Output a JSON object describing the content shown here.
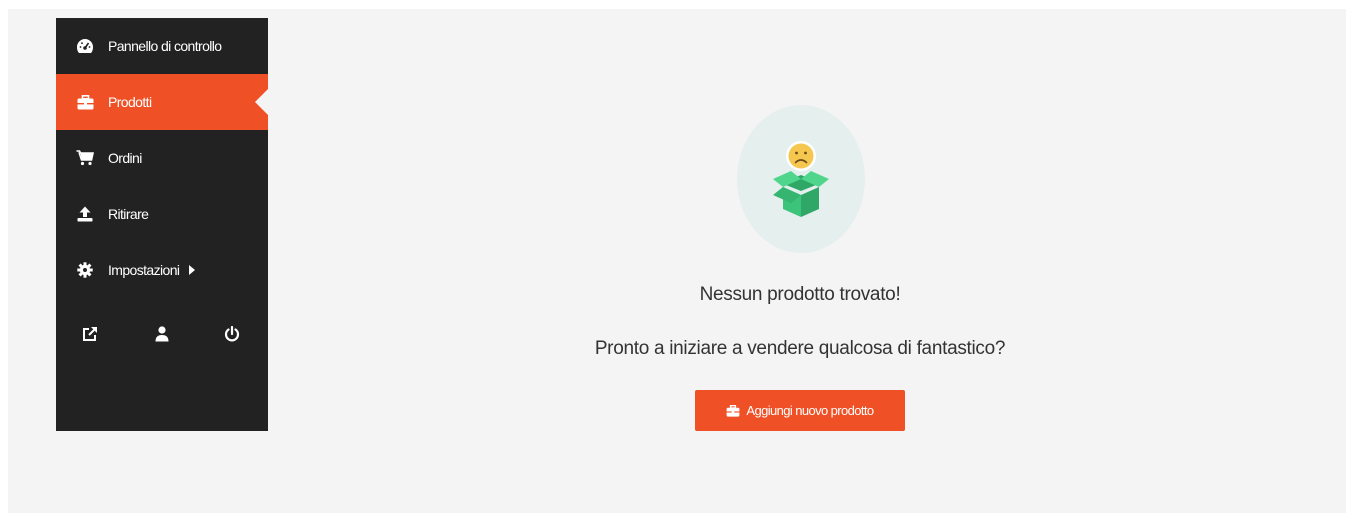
{
  "sidebar": {
    "items": [
      {
        "label": "Pannello di controllo",
        "icon": "dashboard-icon"
      },
      {
        "label": "Prodotti",
        "icon": "briefcase-icon",
        "active": true
      },
      {
        "label": "Ordini",
        "icon": "cart-icon"
      },
      {
        "label": "Ritirare",
        "icon": "upload-icon"
      },
      {
        "label": "Impostazioni",
        "icon": "gear-icon",
        "has_submenu": true
      }
    ],
    "footer_icons": [
      "external-link-icon",
      "user-icon",
      "power-icon"
    ]
  },
  "empty_state": {
    "title": "Nessun prodotto trovato!",
    "subtitle": "Pronto a iniziare a vendere qualcosa di fantastico?",
    "button_label": "Aggiungi nuovo prodotto",
    "illustration": "sad-box-icon"
  },
  "colors": {
    "accent": "#f05025",
    "sidebar_bg": "#222222",
    "content_bg": "#f4f4f4",
    "badge_bg": "#e4efee",
    "box_green": "#3bc47a",
    "face_yellow": "#f5c74e"
  }
}
